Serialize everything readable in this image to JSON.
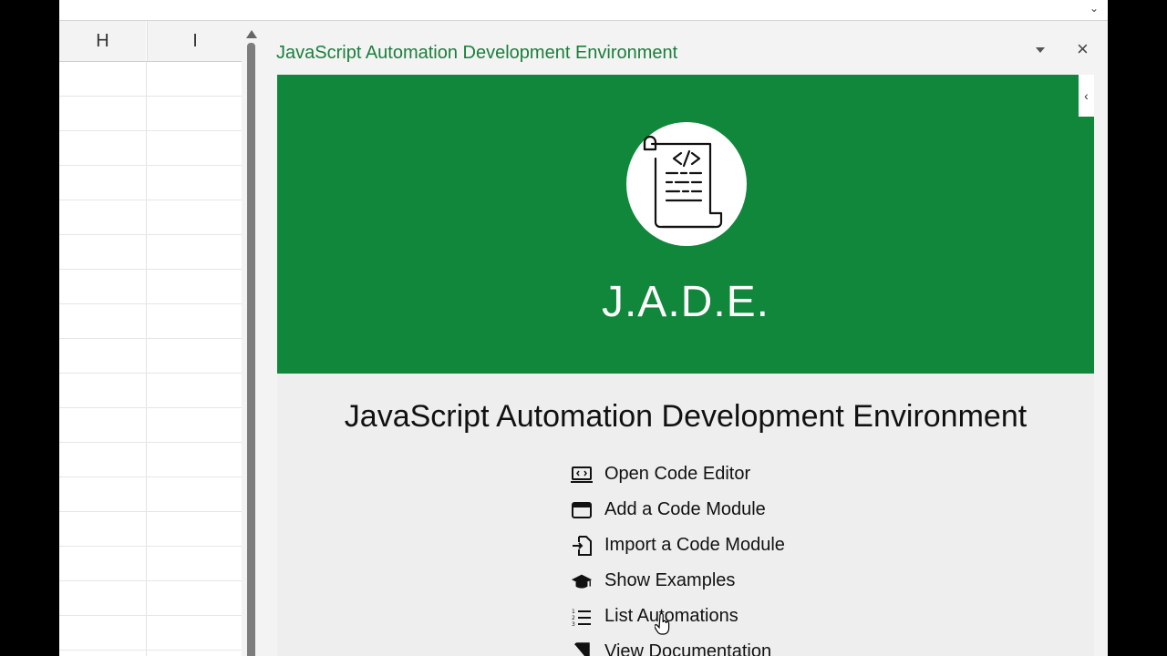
{
  "sheet": {
    "columns": [
      "H",
      "I"
    ]
  },
  "pane": {
    "title": "JavaScript Automation Development Environment"
  },
  "hero": {
    "name": "J.A.D.E.",
    "logo_icon": "code-scroll-icon",
    "background_color": "#10873a"
  },
  "main": {
    "heading": "JavaScript Automation Development Environment",
    "actions": [
      {
        "label": "Open Code Editor",
        "icon": "code-window-icon"
      },
      {
        "label": "Add a Code Module",
        "icon": "window-icon"
      },
      {
        "label": "Import a Code Module",
        "icon": "import-file-icon"
      },
      {
        "label": "Show Examples",
        "icon": "graduation-cap-icon"
      },
      {
        "label": "List Automations",
        "icon": "numbered-list-icon"
      },
      {
        "label": "View Documentation",
        "icon": "book-icon"
      }
    ]
  },
  "colors": {
    "accent": "#1a7f3c"
  }
}
